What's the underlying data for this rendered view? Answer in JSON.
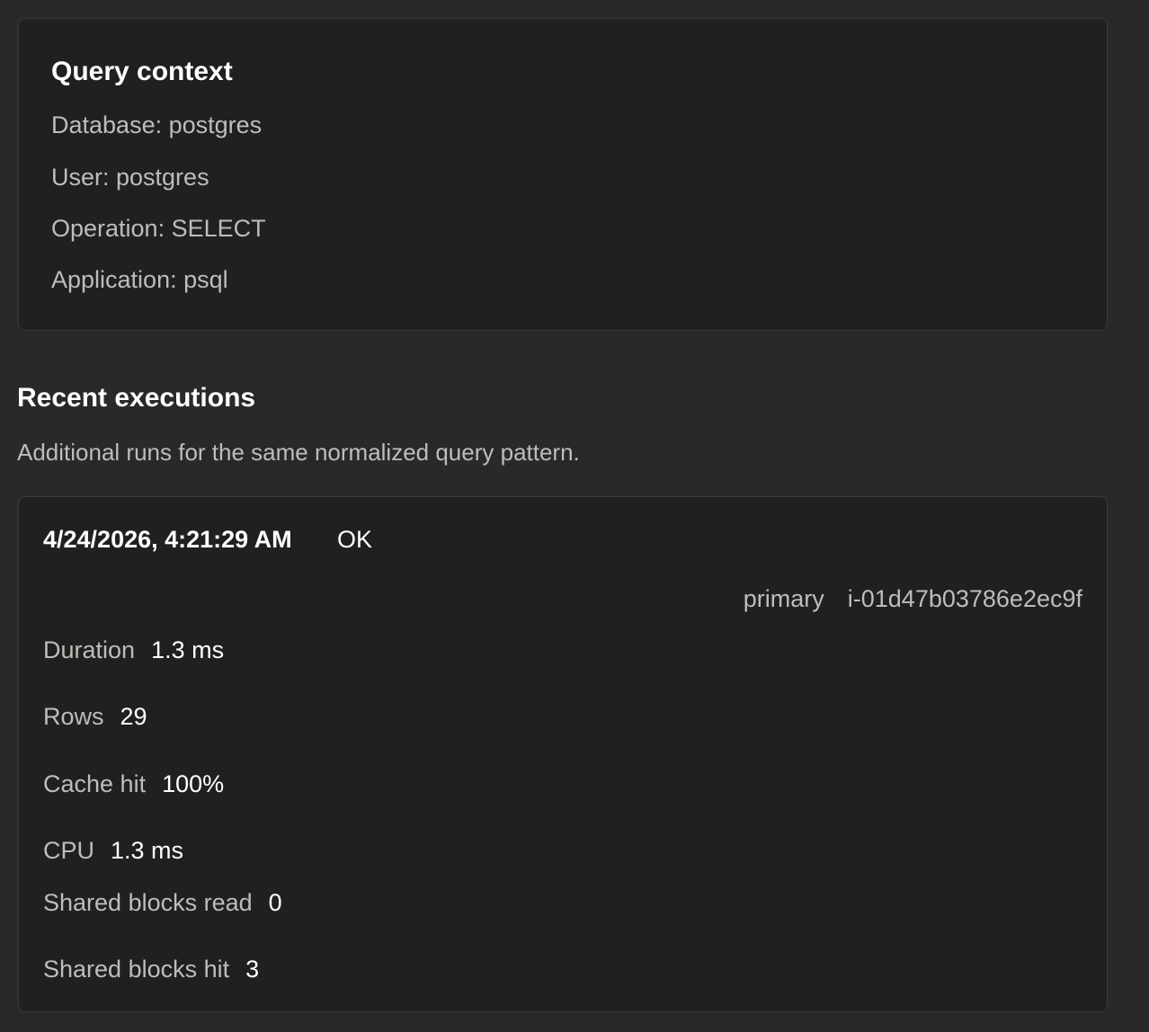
{
  "query_context": {
    "title": "Query context",
    "database": "Database: postgres",
    "user": "User: postgres",
    "operation": "Operation: SELECT",
    "application": "Application: psql"
  },
  "recent_executions": {
    "title": "Recent executions",
    "description": "Additional runs for the same normalized query pattern.",
    "items": [
      {
        "timestamp": "4/24/2026, 4:21:29 AM",
        "status": "OK",
        "role": "primary",
        "instance": "i-01d47b03786e2ec9f",
        "metrics": [
          {
            "label": "Duration",
            "value": "1.3 ms"
          },
          {
            "label": "Rows",
            "value": "29"
          },
          {
            "label": "Cache hit",
            "value": "100%"
          },
          {
            "label": "CPU",
            "value": "1.3 ms"
          },
          {
            "label": "Shared blocks read",
            "value": "0"
          },
          {
            "label": "Shared blocks hit",
            "value": "3"
          }
        ]
      }
    ]
  },
  "colors": {
    "page_background": "#29292a",
    "card_background": "#20201e",
    "card_border": "#3a3a38",
    "muted_text": "#bdbdbb",
    "strong_text": "#ffffff"
  }
}
